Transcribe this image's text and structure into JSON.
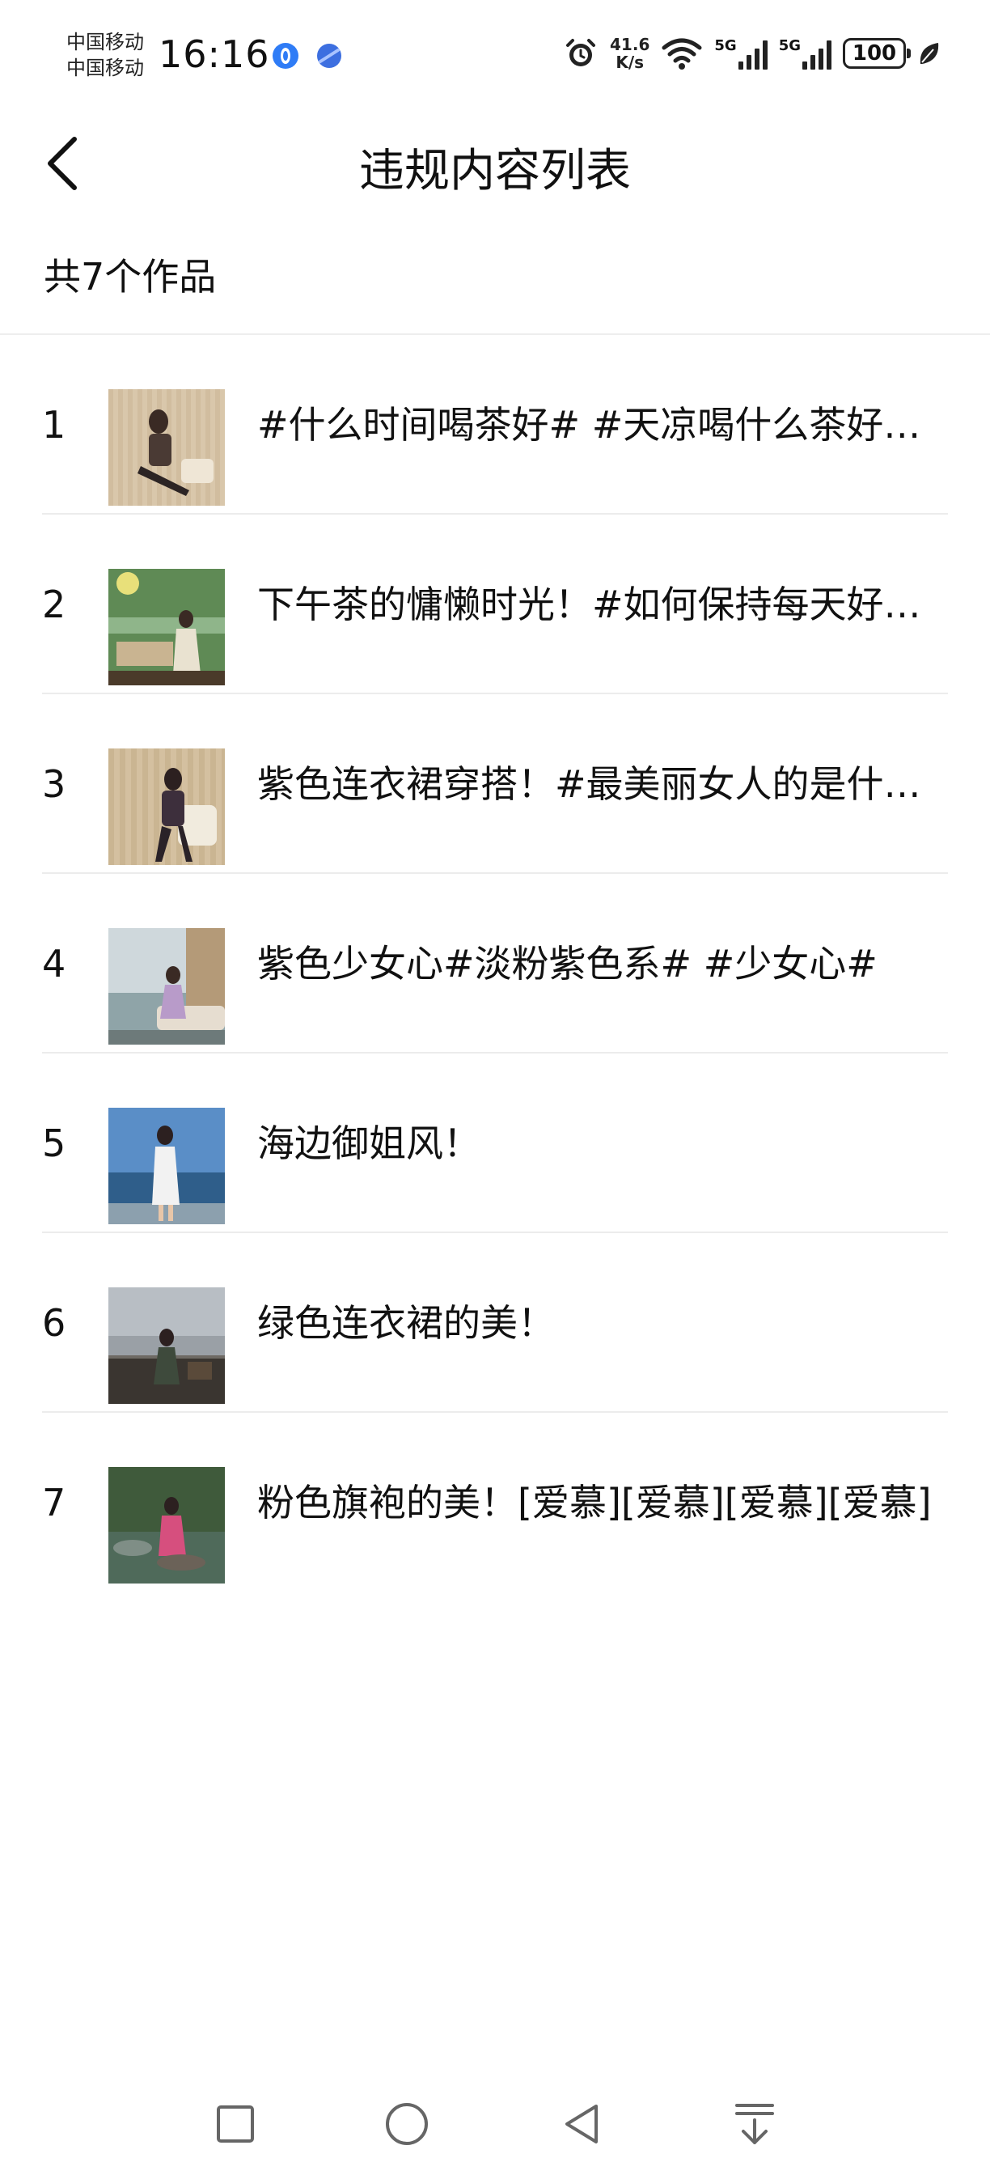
{
  "status_bar": {
    "carrier_1": "中国移动",
    "carrier_2": "中国移动",
    "time": "16:16",
    "net_speed_value": "41.6",
    "net_speed_unit": "K/s",
    "sim1_label": "5G",
    "sim2_label": "5G",
    "battery": "100",
    "icons": [
      "app-icon",
      "browser-icon",
      "alarm-icon",
      "wifi-icon",
      "signal-icon",
      "signal-icon",
      "battery-icon",
      "leaf-icon"
    ]
  },
  "header": {
    "title": "违规内容列表",
    "back_icon": "chevron-left-icon"
  },
  "summary": {
    "count_text": "共7个作品"
  },
  "items": [
    {
      "index": "1",
      "title": "#什么时间喝茶好# #天凉喝什么茶好# #茶",
      "thumb_colors": [
        "#d9c7ab",
        "#4a3a34"
      ]
    },
    {
      "index": "2",
      "title": "下午茶的慵懒时光！#如何保持每天好心情#",
      "thumb_colors": [
        "#5f8a55",
        "#e9e2d0"
      ]
    },
    {
      "index": "3",
      "title": "紫色连衣裙穿搭！#最美丽女人的是什么样子#",
      "thumb_colors": [
        "#d4c0a0",
        "#3d2f3c"
      ]
    },
    {
      "index": "4",
      "title": "紫色少女心#淡粉紫色系# #少女心#",
      "thumb_colors": [
        "#cfd8dc",
        "#b89bc9"
      ]
    },
    {
      "index": "5",
      "title": "海边御姐风！",
      "thumb_colors": [
        "#4a7fb8",
        "#f2f2f2"
      ]
    },
    {
      "index": "6",
      "title": "绿色连衣裙的美！",
      "thumb_colors": [
        "#9aa0a6",
        "#3e4a3c"
      ]
    },
    {
      "index": "7",
      "title": "粉色旗袍的美！[爱慕][爱慕][爱慕][爱慕]",
      "thumb_colors": [
        "#3f5a3b",
        "#d64f7e"
      ]
    }
  ],
  "bottom_nav": {
    "buttons": [
      "recent-apps-icon",
      "home-icon",
      "back-triangle-icon",
      "notification-pull-icon"
    ]
  }
}
